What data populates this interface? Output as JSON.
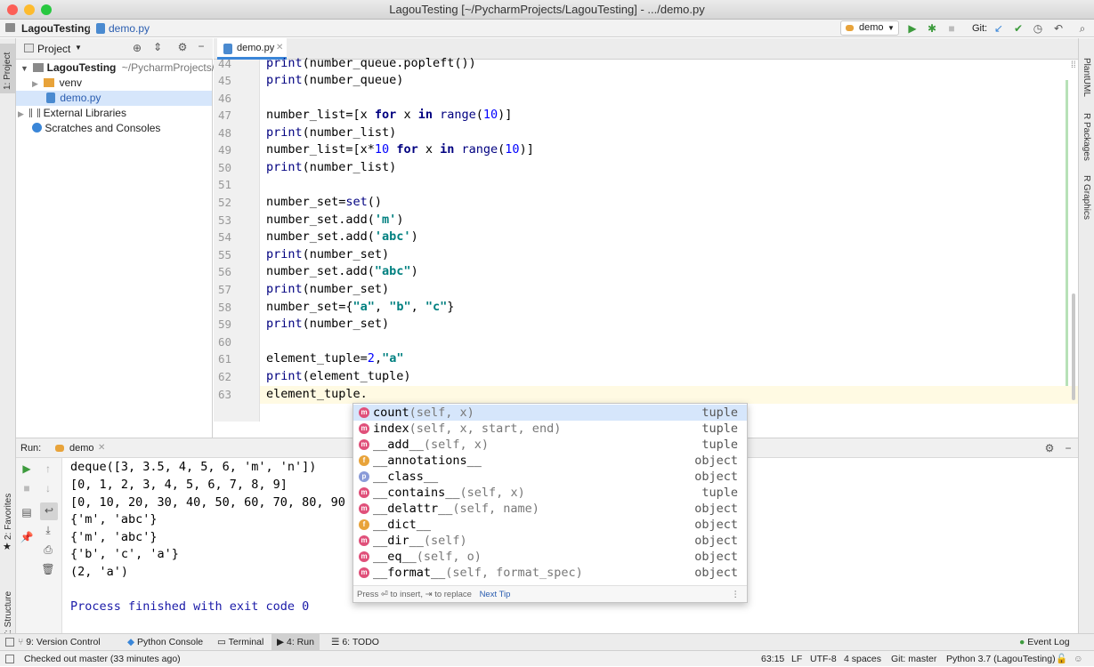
{
  "window": {
    "title": "LagouTesting [~/PycharmProjects/LagouTesting] - .../demo.py"
  },
  "navbar": {
    "project": "LagouTesting",
    "file": "demo.py",
    "run_config": "demo",
    "git_label": "Git:"
  },
  "left_tool": {
    "project_tab": "1: Project",
    "favorites_tab": "2: Favorites",
    "structure_tab": "Z: Structure"
  },
  "right_tool": {
    "tabs": [
      "PlantUML",
      "R Packages",
      "R Graphics"
    ]
  },
  "project_panel": {
    "title": "Project",
    "tree": [
      {
        "label": "LagouTesting",
        "suffix": "~/PycharmProjects/L"
      },
      {
        "label": "venv"
      },
      {
        "label": "demo.py"
      },
      {
        "label": "External Libraries"
      },
      {
        "label": "Scratches and Consoles"
      }
    ]
  },
  "editor": {
    "tab": "demo.py",
    "line_numbers": [
      "44",
      "45",
      "46",
      "47",
      "48",
      "49",
      "50",
      "51",
      "52",
      "53",
      "54",
      "55",
      "56",
      "57",
      "58",
      "59",
      "60",
      "61",
      "62",
      "63"
    ]
  },
  "run": {
    "label": "Run:",
    "config": "demo",
    "output": [
      "deque([3, 3.5, 4, 5, 6, 'm', 'n'])",
      "[0, 1, 2, 3, 4, 5, 6, 7, 8, 9]",
      "[0, 10, 20, 30, 40, 50, 60, 70, 80, 90",
      "{'m', 'abc'}",
      "{'m', 'abc'}",
      "{'b', 'c', 'a'}",
      "(2, 'a')",
      "",
      "Process finished with exit code 0"
    ]
  },
  "completion": {
    "items": [
      {
        "icon": "m",
        "name": "count",
        "args": "(self, x)",
        "type": "tuple"
      },
      {
        "icon": "m",
        "name": "index",
        "args": "(self, x, start, end)",
        "type": "tuple"
      },
      {
        "icon": "m",
        "name": "__add__",
        "args": "(self, x)",
        "type": "tuple"
      },
      {
        "icon": "f",
        "name": "__annotations__",
        "args": "",
        "type": "object"
      },
      {
        "icon": "p",
        "name": "__class__",
        "args": "",
        "type": "object"
      },
      {
        "icon": "m",
        "name": "__contains__",
        "args": "(self, x)",
        "type": "tuple"
      },
      {
        "icon": "m",
        "name": "__delattr__",
        "args": "(self, name)",
        "type": "object"
      },
      {
        "icon": "f",
        "name": "__dict__",
        "args": "",
        "type": "object"
      },
      {
        "icon": "m",
        "name": "__dir__",
        "args": "(self)",
        "type": "object"
      },
      {
        "icon": "m",
        "name": "__eq__",
        "args": "(self, o)",
        "type": "object"
      },
      {
        "icon": "m",
        "name": "__format__",
        "args": "(self, format_spec)",
        "type": "object"
      }
    ],
    "footer_text": "Press ⏎ to insert, ⇥ to replace",
    "next_tip": "Next Tip"
  },
  "bottom_tabs": [
    "9: Version Control",
    "Python Console",
    "Terminal",
    "4: Run",
    "6: TODO",
    "Event Log"
  ],
  "status": {
    "message": "Checked out master (33 minutes ago)",
    "position": "63:15",
    "line_sep": "LF",
    "encoding": "UTF-8",
    "indent": "4 spaces",
    "git": "Git: master",
    "interpreter": "Python 3.7 (LagouTesting)"
  },
  "colors": {
    "accent": "#3a86d8",
    "selection": "#d6e6fb",
    "current_line": "#fffae3",
    "run_green": "#3d9b3d"
  }
}
